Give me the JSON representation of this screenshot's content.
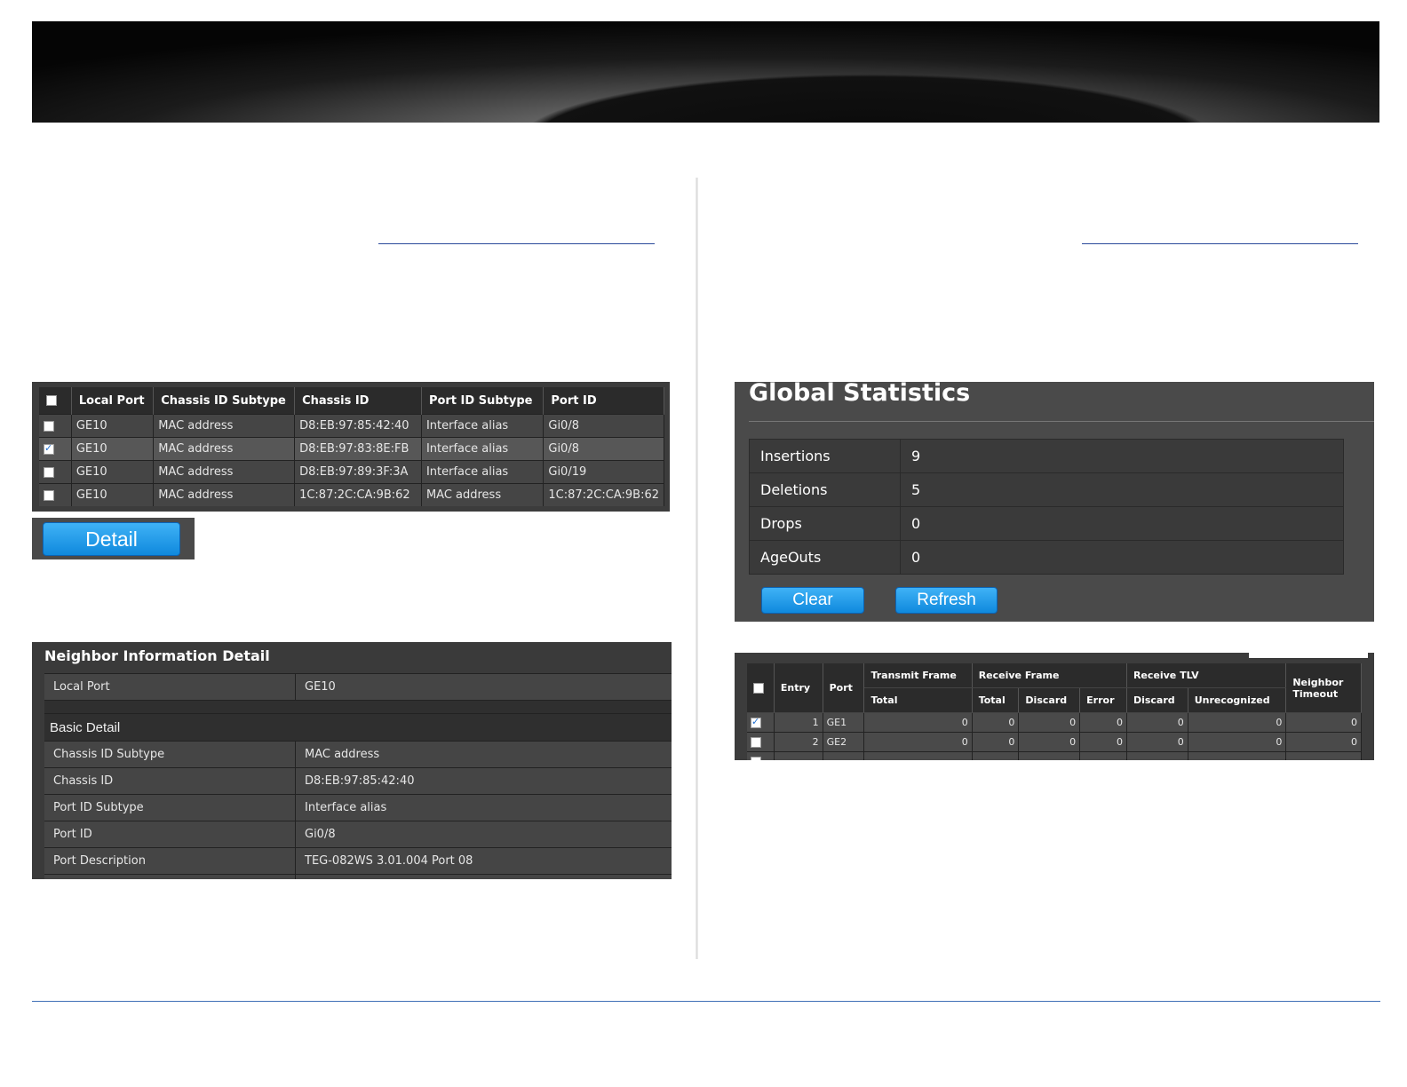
{
  "neighbor_table": {
    "headers": [
      "Local Port",
      "Chassis ID Subtype",
      "Chassis ID",
      "Port ID Subtype",
      "Port ID"
    ],
    "rows": [
      {
        "checked": false,
        "local_port": "GE10",
        "chassis_subtype": "MAC address",
        "chassis_id": "D8:EB:97:85:42:40",
        "port_subtype": "Interface alias",
        "port_id": "Gi0/8"
      },
      {
        "checked": true,
        "local_port": "GE10",
        "chassis_subtype": "MAC address",
        "chassis_id": "D8:EB:97:83:8E:FB",
        "port_subtype": "Interface alias",
        "port_id": "Gi0/8"
      },
      {
        "checked": false,
        "local_port": "GE10",
        "chassis_subtype": "MAC address",
        "chassis_id": "D8:EB:97:89:3F:3A",
        "port_subtype": "Interface alias",
        "port_id": "Gi0/19"
      },
      {
        "checked": false,
        "local_port": "GE10",
        "chassis_subtype": "MAC address",
        "chassis_id": "1C:87:2C:CA:9B:62",
        "port_subtype": "MAC address",
        "port_id": "1C:87:2C:CA:9B:62"
      }
    ],
    "detail_button": "Detail"
  },
  "neighbor_detail": {
    "title": "Neighbor Information Detail",
    "local_port_label": "Local Port",
    "local_port_value": "GE10",
    "section": "Basic Detail",
    "rows": [
      {
        "label": "Chassis ID Subtype",
        "value": "MAC address"
      },
      {
        "label": "Chassis ID",
        "value": "D8:EB:97:85:42:40"
      },
      {
        "label": "Port ID Subtype",
        "value": "Interface alias"
      },
      {
        "label": "Port ID",
        "value": "Gi0/8"
      },
      {
        "label": "Port Description",
        "value": "TEG-082WS 3.01.004 Port 08"
      }
    ]
  },
  "global_stats": {
    "title": "Global Statistics",
    "rows": [
      {
        "label": "Insertions",
        "value": "9"
      },
      {
        "label": "Deletions",
        "value": "5"
      },
      {
        "label": "Drops",
        "value": "0"
      },
      {
        "label": "AgeOuts",
        "value": "0"
      }
    ],
    "clear_button": "Clear",
    "refresh_button": "Refresh"
  },
  "port_stats": {
    "headers": {
      "entry": "Entry",
      "port": "Port",
      "transmit_frame": "Transmit Frame",
      "receive_frame": "Receive Frame",
      "receive_tlv": "Receive TLV",
      "neighbor_timeout": "Neighbor Timeout",
      "total": "Total",
      "rx_total": "Total",
      "discard": "Discard",
      "error": "Error",
      "tlv_discard": "Discard",
      "unrecognized": "Unrecognized"
    },
    "rows": [
      {
        "checked": true,
        "entry": "1",
        "port": "GE1",
        "tx_total": "0",
        "rx_total": "0",
        "rx_discard": "0",
        "rx_error": "0",
        "tlv_discard": "0",
        "tlv_unrec": "0",
        "timeout": "0"
      },
      {
        "checked": false,
        "entry": "2",
        "port": "GE2",
        "tx_total": "0",
        "rx_total": "0",
        "rx_discard": "0",
        "rx_error": "0",
        "tlv_discard": "0",
        "tlv_unrec": "0",
        "timeout": "0"
      }
    ]
  },
  "colors": {
    "accent_blue": "#1f8fe8",
    "panel_dark": "#3a3a3a",
    "footer_line": "#3f6fb6"
  }
}
